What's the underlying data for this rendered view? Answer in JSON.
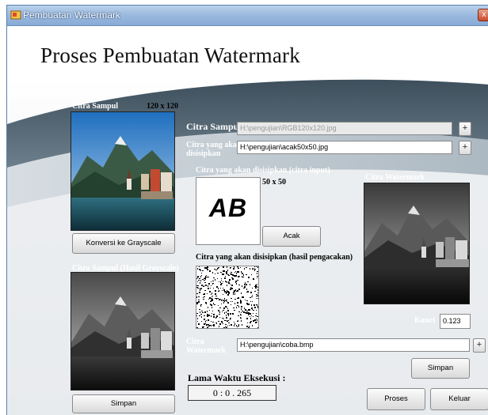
{
  "window": {
    "title": "Pembuatan Watermark",
    "close_glyph": "x"
  },
  "heading": "Proses Pembuatan Watermark",
  "left_panel": {
    "citra_sampul_label": "Citra Sampul",
    "citra_sampul_size": "120 x 120",
    "convert_button": "Konversi ke Grayscale",
    "grayscale_label": "Citra Sampul (Hasil Grayscale)",
    "save_button": "Simpan"
  },
  "form": {
    "citra_sampul_label": "Citra Sampul",
    "citra_sampul_path": "H:\\pengujian\\RGB120x120.jpg",
    "disisipkan_label_1": "Citra yang akan",
    "disisipkan_label_2": "disisipkan",
    "disisipkan_path": "H:\\pengujian\\acak50x50.jpg",
    "input_image_label": "Citra yang akan disisipkan (citra input)",
    "input_image_size": "50 x 50",
    "input_image_text": "AB",
    "acak_button": "Acak",
    "scrambled_label": "Citra yang akan disisipkan (hasil pengacakan)",
    "plus_glyph": "+"
  },
  "watermark_panel": {
    "label": "Citra Watermark",
    "kunci_label": "Kunci",
    "kunci_value": "0.123"
  },
  "output": {
    "label_1": "Citra",
    "label_2": "Watermark",
    "path": "H:\\pengujian\\coba.bmp",
    "save_button": "Simpan"
  },
  "timing": {
    "label": "Lama Waktu Eksekusi :",
    "value": "0 : 0 . 265"
  },
  "actions": {
    "proses_button": "Proses",
    "keluar_button": "Keluar"
  },
  "icons": [
    "app-icon",
    "close-icon"
  ]
}
